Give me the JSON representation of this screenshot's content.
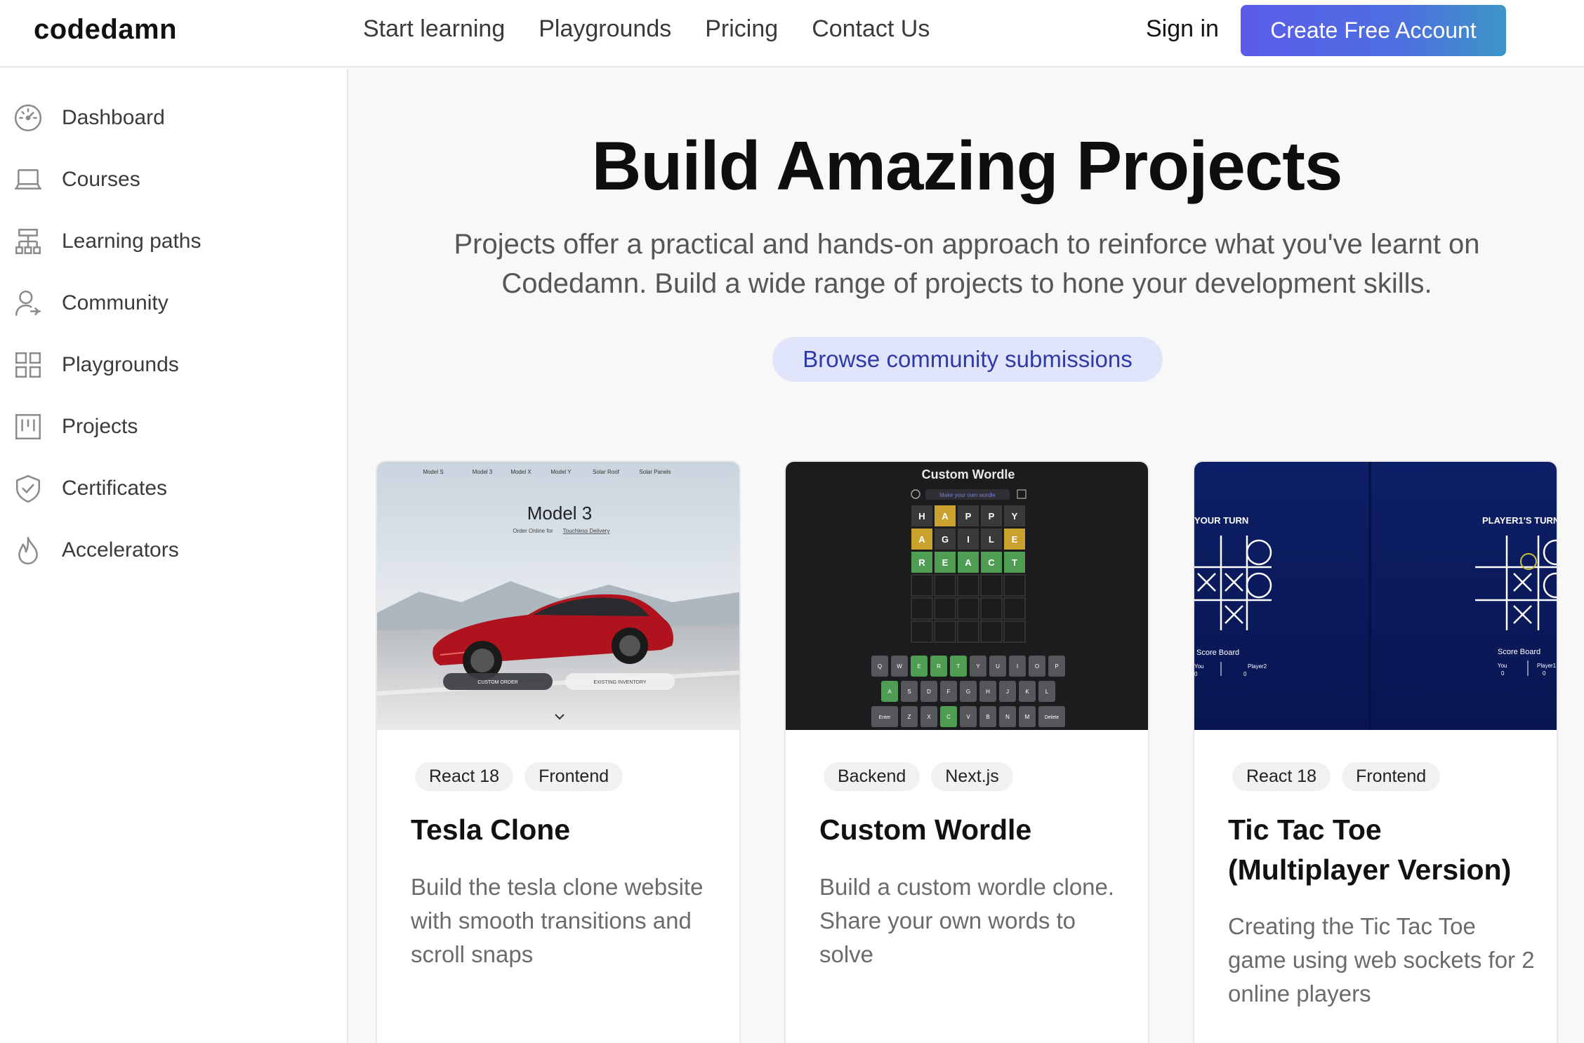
{
  "app": {
    "logo": "codedamn"
  },
  "topnav": {
    "links": [
      "Start learning",
      "Playgrounds",
      "Pricing",
      "Contact Us"
    ],
    "signin": "Sign in",
    "cta": "Create Free Account"
  },
  "sidebar": {
    "items": [
      {
        "label": "Dashboard",
        "icon": "gauge-icon"
      },
      {
        "label": "Courses",
        "icon": "laptop-icon"
      },
      {
        "label": "Learning paths",
        "icon": "sitemap-icon"
      },
      {
        "label": "Community",
        "icon": "user-community-icon"
      },
      {
        "label": "Playgrounds",
        "icon": "grid-icon"
      },
      {
        "label": "Projects",
        "icon": "kanban-icon"
      },
      {
        "label": "Certificates",
        "icon": "shield-check-icon"
      },
      {
        "label": "Accelerators",
        "icon": "flame-icon"
      }
    ]
  },
  "hero": {
    "title": "Build Amazing Projects",
    "subtitle": "Projects offer a practical and hands-on approach to reinforce what you've learnt on Codedamn. Build a wide range of projects to hone your development skills.",
    "browse_button": "Browse community submissions"
  },
  "cards": [
    {
      "title": "Tesla Clone",
      "tags": [
        "React 18",
        "Frontend"
      ],
      "description": "Build the tesla clone website with smooth transitions and scroll snaps",
      "badge_color": "#d8f3df",
      "thumb": {
        "nav": [
          "Model S",
          "Model 3",
          "Model X",
          "Model Y",
          "Solar Roof",
          "Solar Panels"
        ],
        "heading": "Model 3",
        "subheading": "Order Online for",
        "subheading_link": "Touchless Delivery",
        "btn_primary": "CUSTOM ORDER",
        "btn_secondary": "EXISTING INVENTORY"
      }
    },
    {
      "title": "Custom Wordle",
      "tags": [
        "Backend",
        "Next.js"
      ],
      "description": "Build a custom wordle clone. Share your own words to solve",
      "badge_color": "#f8dcdc",
      "thumb": {
        "heading": "Custom Wordle",
        "input_placeholder": "Make your own wordle",
        "rows": [
          [
            [
              "H",
              "gray"
            ],
            [
              "A",
              "yellow"
            ],
            [
              "P",
              "gray"
            ],
            [
              "P",
              "gray"
            ],
            [
              "Y",
              "gray"
            ]
          ],
          [
            [
              "A",
              "yellow"
            ],
            [
              "G",
              "gray"
            ],
            [
              "I",
              "gray"
            ],
            [
              "L",
              "gray"
            ],
            [
              "E",
              "yellow"
            ]
          ],
          [
            [
              "R",
              "green"
            ],
            [
              "E",
              "green"
            ],
            [
              "A",
              "green"
            ],
            [
              "C",
              "green"
            ],
            [
              "T",
              "green"
            ]
          ]
        ],
        "keyboard": [
          [
            [
              "Q",
              "gray"
            ],
            [
              "W",
              "gray"
            ],
            [
              "E",
              "green"
            ],
            [
              "R",
              "green"
            ],
            [
              "T",
              "green"
            ],
            [
              "Y",
              "gray"
            ],
            [
              "U",
              "gray"
            ],
            [
              "I",
              "gray"
            ],
            [
              "O",
              "gray"
            ],
            [
              "P",
              "gray"
            ]
          ],
          [
            [
              "A",
              "green"
            ],
            [
              "S",
              "gray"
            ],
            [
              "D",
              "gray"
            ],
            [
              "F",
              "gray"
            ],
            [
              "G",
              "gray"
            ],
            [
              "H",
              "gray"
            ],
            [
              "J",
              "gray"
            ],
            [
              "K",
              "gray"
            ],
            [
              "L",
              "gray"
            ]
          ],
          [
            [
              "Enter",
              "gray"
            ],
            [
              "Z",
              "gray"
            ],
            [
              "X",
              "gray"
            ],
            [
              "C",
              "green"
            ],
            [
              "V",
              "gray"
            ],
            [
              "B",
              "gray"
            ],
            [
              "N",
              "gray"
            ],
            [
              "M",
              "gray"
            ],
            [
              "Delete",
              "gray"
            ]
          ]
        ]
      }
    },
    {
      "title": "Tic Tac Toe (Multiplayer Version)",
      "tags": [
        "React 18",
        "Frontend"
      ],
      "description": "Creating the Tic Tac Toe game using web sockets for 2 online players",
      "badge_color": "#d8f3df",
      "thumb": {
        "left_turn": "YOUR TURN",
        "right_turn": "PLAYER1'S TURN",
        "scoreboard": "Score Board",
        "left_scores": [
          [
            "You",
            "0"
          ],
          [
            "Player2",
            "0"
          ]
        ],
        "right_scores": [
          [
            "You",
            "0"
          ],
          [
            "Player1",
            "0"
          ]
        ]
      }
    }
  ]
}
